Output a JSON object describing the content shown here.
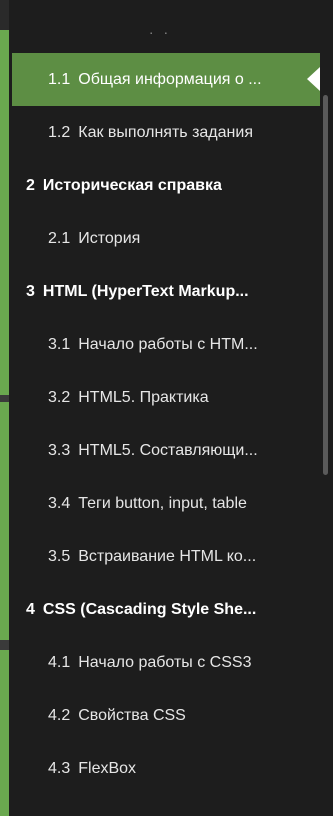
{
  "header": {
    "indicator": "· ·"
  },
  "toc": {
    "items": [
      {
        "num": "1.1",
        "label": "Общая информация о ...",
        "level": "sub",
        "active": true
      },
      {
        "num": "1.2",
        "label": "Как выполнять задания",
        "level": "sub"
      },
      {
        "num": "2",
        "label": "Историческая справка",
        "level": "sec"
      },
      {
        "num": "2.1",
        "label": "История",
        "level": "sub"
      },
      {
        "num": "3",
        "label": "HTML (HyperText Markup...",
        "level": "sec"
      },
      {
        "num": "3.1",
        "label": "Начало работы с HTM...",
        "level": "sub"
      },
      {
        "num": "3.2",
        "label": "HTML5. Практика",
        "level": "sub"
      },
      {
        "num": "3.3",
        "label": "HTML5. Составляющи...",
        "level": "sub"
      },
      {
        "num": "3.4",
        "label": "Теги button, input, table",
        "level": "sub"
      },
      {
        "num": "3.5",
        "label": "Встраивание HTML ко...",
        "level": "sub"
      },
      {
        "num": "4",
        "label": "CSS (Cascading Style She...",
        "level": "sec"
      },
      {
        "num": "4.1",
        "label": "Начало работы с CSS3",
        "level": "sub"
      },
      {
        "num": "4.2",
        "label": "Свойства CSS",
        "level": "sub"
      },
      {
        "num": "4.3",
        "label": "FlexBox",
        "level": "sub"
      }
    ]
  },
  "colors": {
    "active_bg": "#5d8e44",
    "progress": "#6aa84f",
    "background": "#1d1d1d",
    "text": "#e6e6e6"
  }
}
